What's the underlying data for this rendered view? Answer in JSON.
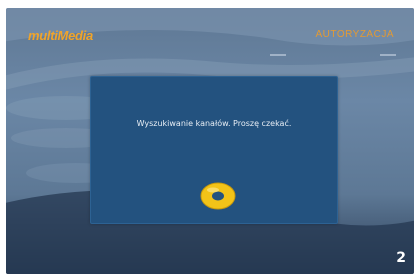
{
  "header": {
    "logo_text": "multiMedia",
    "section_title": "AUTORYZACJA"
  },
  "dialog": {
    "message": "Wyszukiwanie kanałów. Proszę czekać.",
    "spinner_icon": "loading-disc-icon"
  },
  "page_badge": "2",
  "colors": {
    "accent_orange": "#f0a42a",
    "dialog_blue": "#23527f",
    "spinner_yellow": "#f2c318"
  }
}
